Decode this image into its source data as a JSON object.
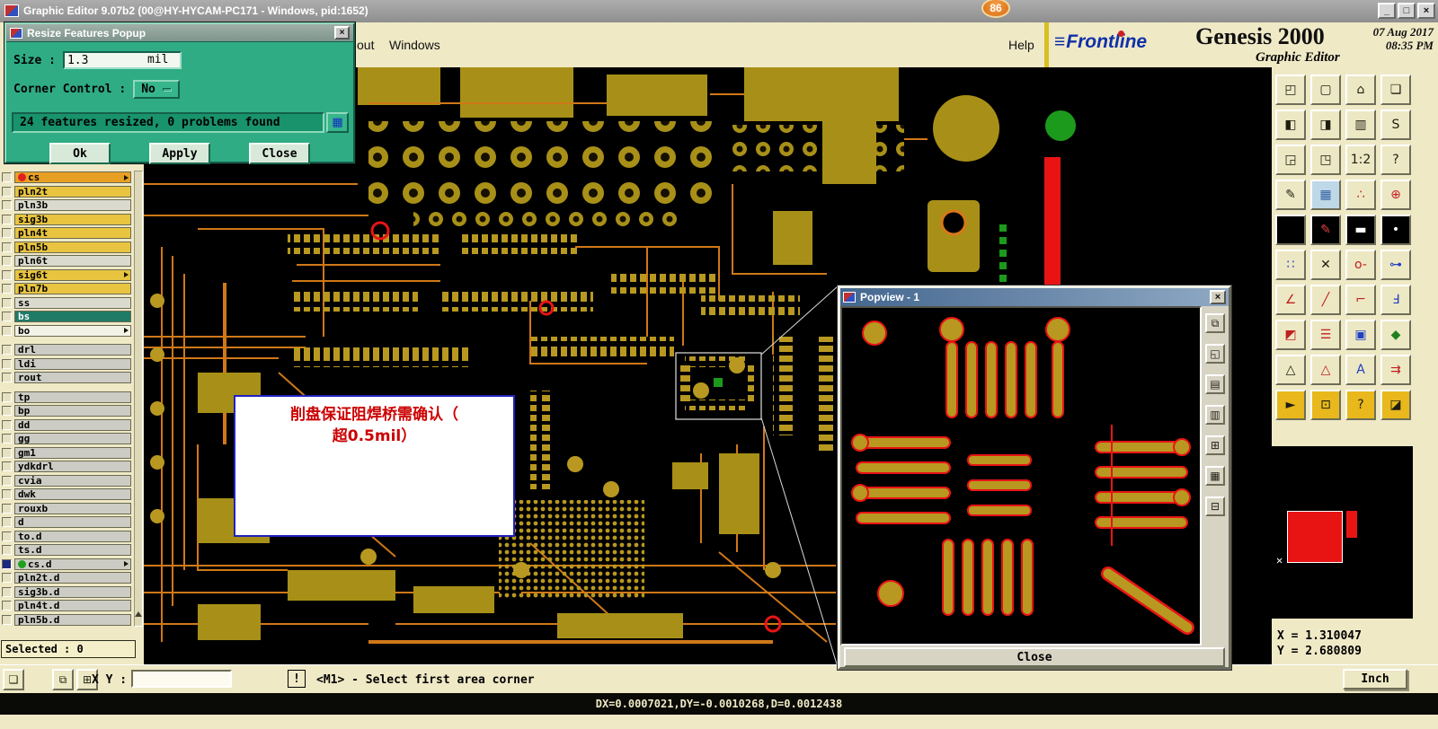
{
  "window": {
    "title": "Graphic Editor 9.07b2 (00@HY-HYCAM-PC171 - Windows, pid:1652)",
    "controls": {
      "minimize": "_",
      "maximize": "□",
      "close": "×"
    }
  },
  "badge": {
    "value": "86"
  },
  "menu": {
    "item_out": "out",
    "item_windows": "Windows",
    "help": "Help"
  },
  "brand": {
    "logo_icon": "≡",
    "logo": "Frontline",
    "product": "Genesis 2000",
    "date": "07 Aug 2017",
    "time": "08:35 PM",
    "subtitle": "Graphic Editor"
  },
  "resize_dialog": {
    "title": "Resize Features Popup",
    "title_close": "×",
    "size_label": "Size :",
    "size_value": "1.3",
    "size_unit": "mil",
    "corner_label": "Corner Control :",
    "corner_value": "No",
    "status": "24 features resized, 0 problems found",
    "report_icon": "▦",
    "ok": "Ok",
    "apply": "Apply",
    "close": "Close"
  },
  "sidebar": {
    "selected_status": "Selected : 0",
    "layers": [
      {
        "label": "cs",
        "bg": "#E8A024",
        "dot": "red",
        "arrow": true
      },
      {
        "label": "pln2t",
        "bg": "#E8C440"
      },
      {
        "label": "pln3b",
        "bg": "#DADACE"
      },
      {
        "label": "sig3b",
        "bg": "#E8C440"
      },
      {
        "label": "pln4t",
        "bg": "#E8C440"
      },
      {
        "label": "pln5b",
        "bg": "#E8C440"
      },
      {
        "label": "pln6t",
        "bg": "#DADACE"
      },
      {
        "label": "sig6t",
        "bg": "#E8C440",
        "arrow": true
      },
      {
        "label": "pln7b",
        "bg": "#E8C440"
      },
      {
        "label": "ss",
        "bg": "#DADACE"
      },
      {
        "label": "bs",
        "bg": "#1F7A66",
        "fg": "#FFFFFF",
        "selected": true
      },
      {
        "label": "bo",
        "bg": "#F2F2E6",
        "arrow": true
      },
      {
        "label": "drl",
        "bg": "#CCCCC4",
        "gap": true
      },
      {
        "label": "ldi",
        "bg": "#CCCCC4"
      },
      {
        "label": "rout",
        "bg": "#CCCCC4"
      },
      {
        "label": "tp",
        "bg": "#CCCCC4",
        "gap": true
      },
      {
        "label": "bp",
        "bg": "#CCCCC4"
      },
      {
        "label": "dd",
        "bg": "#CCCCC4"
      },
      {
        "label": "gg",
        "bg": "#CCCCC4"
      },
      {
        "label": "gm1",
        "bg": "#CCCCC4"
      },
      {
        "label": "ydkdrl",
        "bg": "#CCCCC4"
      },
      {
        "label": "cvia",
        "bg": "#CCCCC4"
      },
      {
        "label": "dwk",
        "bg": "#CCCCC4"
      },
      {
        "label": "rouxb",
        "bg": "#CCCCC4"
      },
      {
        "label": "d",
        "bg": "#CCCCC4"
      },
      {
        "label": "to.d",
        "bg": "#CCCCC4"
      },
      {
        "label": "ts.d",
        "bg": "#CCCCC4"
      },
      {
        "label": "cs.d",
        "bg": "#CCCCC4",
        "dot": "green",
        "arrow": true,
        "checked": true
      },
      {
        "label": "pln2t.d",
        "bg": "#CCCCC4"
      },
      {
        "label": "sig3b.d",
        "bg": "#CCCCC4"
      },
      {
        "label": "pln4t.d",
        "bg": "#CCCCC4"
      },
      {
        "label": "pln5b.d",
        "bg": "#CCCCC4"
      }
    ]
  },
  "canvas": {
    "annotation_line1": "削盘保证阻焊桥需确认（",
    "annotation_line2": "超0.5mil）"
  },
  "popview": {
    "title": "Popview - 1",
    "title_close": "×",
    "close_button": "Close",
    "tools": [
      {
        "name": "popview-capture-icon",
        "glyph": "⧉"
      },
      {
        "name": "popview-up-icon",
        "glyph": "◱"
      },
      {
        "name": "popview-layers-icon",
        "glyph": "▤"
      },
      {
        "name": "popview-grid-icon",
        "glyph": "▥"
      },
      {
        "name": "popview-zoom-in-icon",
        "glyph": "⊞"
      },
      {
        "name": "popview-frame-icon",
        "glyph": "▦"
      },
      {
        "name": "popview-zoom-out-icon",
        "glyph": "⊟"
      }
    ]
  },
  "right_toolbar": {
    "icons": [
      {
        "name": "view-corner-icon",
        "glyph": "◰"
      },
      {
        "name": "screen-icon",
        "glyph": "▢"
      },
      {
        "name": "home-view-icon",
        "glyph": "⌂"
      },
      {
        "name": "windows-tile-icon",
        "glyph": "❏"
      },
      {
        "name": "shift-left-icon",
        "glyph": "◧"
      },
      {
        "name": "shift-right-icon",
        "glyph": "◨"
      },
      {
        "name": "clipboard-icon",
        "glyph": "▥"
      },
      {
        "name": "serpentine-icon",
        "glyph": "S"
      },
      {
        "name": "zoom-fit-icon",
        "glyph": "◲"
      },
      {
        "name": "zoom-sel-icon",
        "glyph": "◳"
      },
      {
        "name": "zoom-ratio-icon",
        "glyph": "1:2"
      },
      {
        "name": "help-tool-icon",
        "glyph": "?"
      },
      {
        "name": "sketch-pen-icon",
        "glyph": "✎"
      },
      {
        "name": "grid-icon",
        "glyph": "▦",
        "bg": "#BFD8E8",
        "fg": "#3060A0"
      },
      {
        "name": "snap-points-icon",
        "glyph": "∴",
        "fg": "#C02020"
      },
      {
        "name": "origin-icon",
        "glyph": "⊕",
        "fg": "#C02020"
      },
      {
        "name": "blank-layer-icon",
        "glyph": "",
        "bg": "#000000"
      },
      {
        "name": "redline-pen-icon",
        "glyph": "✎",
        "bg": "#000000",
        "fg": "#E04040"
      },
      {
        "name": "ruler-icon",
        "glyph": "▬",
        "bg": "#000000",
        "fg": "#FFFFFF"
      },
      {
        "name": "probe-dot-icon",
        "glyph": "•",
        "bg": "#000000",
        "fg": "#FFFFFF"
      },
      {
        "name": "net-points-icon",
        "glyph": "∷",
        "fg": "#2040C0"
      },
      {
        "name": "delete-x-icon",
        "glyph": "✕"
      },
      {
        "name": "circle-minus-icon",
        "glyph": "o-",
        "fg": "#C02020"
      },
      {
        "name": "pad-link-icon",
        "glyph": "⊶",
        "fg": "#2040C0"
      },
      {
        "name": "angle-measure-icon",
        "glyph": "∠",
        "fg": "#C02020"
      },
      {
        "name": "slope-line-icon",
        "glyph": "╱",
        "fg": "#C02020"
      },
      {
        "name": "arc-tool-icon",
        "glyph": "⌐",
        "fg": "#C02020"
      },
      {
        "name": "flip-f-icon",
        "glyph": "Ⅎ",
        "fg": "#2040C0"
      },
      {
        "name": "pad-frame-icon",
        "glyph": "◩",
        "fg": "#C02020"
      },
      {
        "name": "dash-lines-icon",
        "glyph": "☰",
        "fg": "#C02020"
      },
      {
        "name": "box-export-icon",
        "glyph": "▣",
        "fg": "#2040C0"
      },
      {
        "name": "shapes-icon",
        "glyph": "◆",
        "fg": "#208020"
      },
      {
        "name": "triangle-white-icon",
        "glyph": "△"
      },
      {
        "name": "triangle-red-icon",
        "glyph": "△",
        "fg": "#C02020"
      },
      {
        "name": "text-a-icon",
        "glyph": "A",
        "fg": "#2040C0"
      },
      {
        "name": "multi-arrow-icon",
        "glyph": "⇉",
        "fg": "#C02020"
      },
      {
        "name": "select-pointer-icon",
        "glyph": "►",
        "bg": "#E8B81C"
      },
      {
        "name": "select-area-icon",
        "glyph": "⊡",
        "bg": "#E8B81C"
      },
      {
        "name": "select-query-icon",
        "glyph": "?",
        "bg": "#E8B81C"
      },
      {
        "name": "select-dark-icon",
        "glyph": "◪",
        "bg": "#E8B81C"
      }
    ]
  },
  "coord_panel": {
    "x": "X = 1.310047",
    "y": "Y = 2.680809",
    "unit": "Inch"
  },
  "bottom_toolbar": {
    "xy_label": "X Y :",
    "xy_value": "",
    "alert": "!",
    "hint": "<M1> - Select first area corner",
    "tools": [
      {
        "name": "pages-icon",
        "glyph": "❏"
      },
      {
        "name": "overlay-icon",
        "glyph": "⧉"
      },
      {
        "name": "grid-toggle-icon",
        "glyph": "⊞"
      }
    ]
  },
  "status_bar": {
    "deltas": "DX=0.0007021,DY=-0.0010268,D=0.0012438"
  }
}
